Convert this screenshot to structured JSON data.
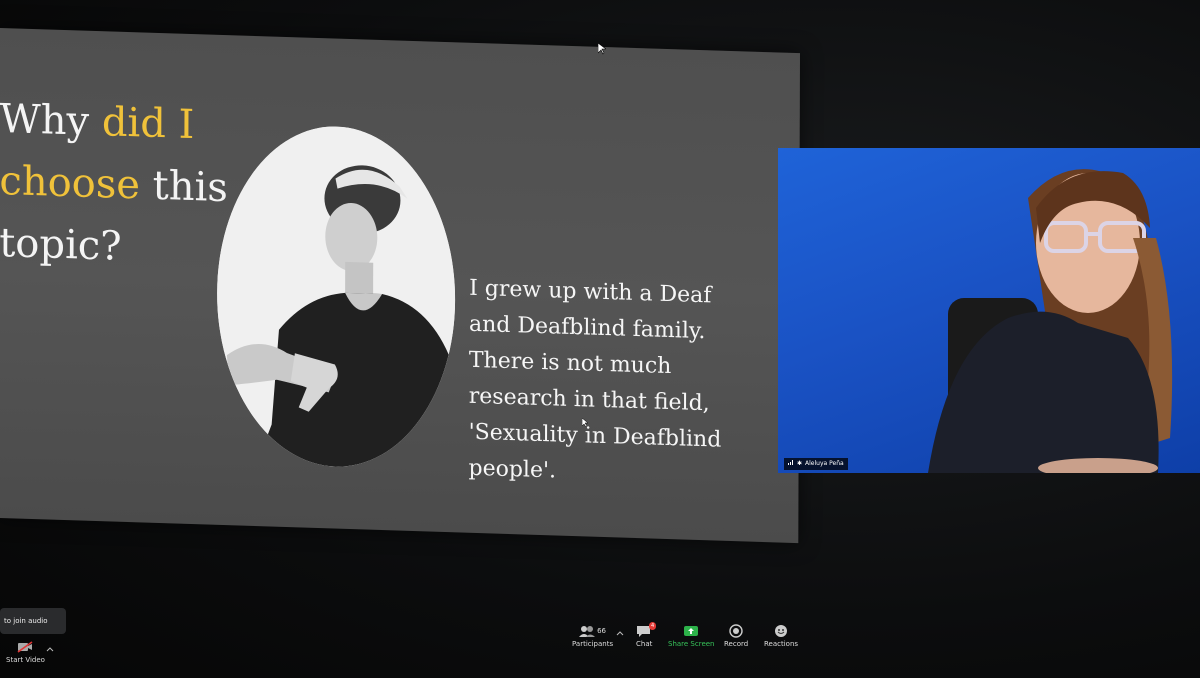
{
  "slide": {
    "title_parts": [
      "Why ",
      "did I",
      " ",
      "choose",
      " this topic?"
    ],
    "body": "I grew up with a Deaf and Deafblind family. There is not much research in that field, 'Sexuality in Deafblind people'.",
    "highlight_color": "#f0c23a"
  },
  "video": {
    "participant_name": "Aleluya Peña",
    "background_color": "#1f63d8"
  },
  "toolbar": {
    "join_audio": "to join audio",
    "start_video": "Start Video",
    "participants_count": "66",
    "participants": "Participants",
    "chat": "Chat",
    "chat_badge": "4",
    "share_screen": "Share Screen",
    "record": "Record",
    "reactions": "Reactions"
  },
  "icons": [
    "camera-off-icon",
    "participants-icon",
    "chat-icon",
    "share-screen-icon",
    "record-icon",
    "reactions-icon",
    "signal-icon",
    "pin-icon",
    "cursor-icon"
  ]
}
